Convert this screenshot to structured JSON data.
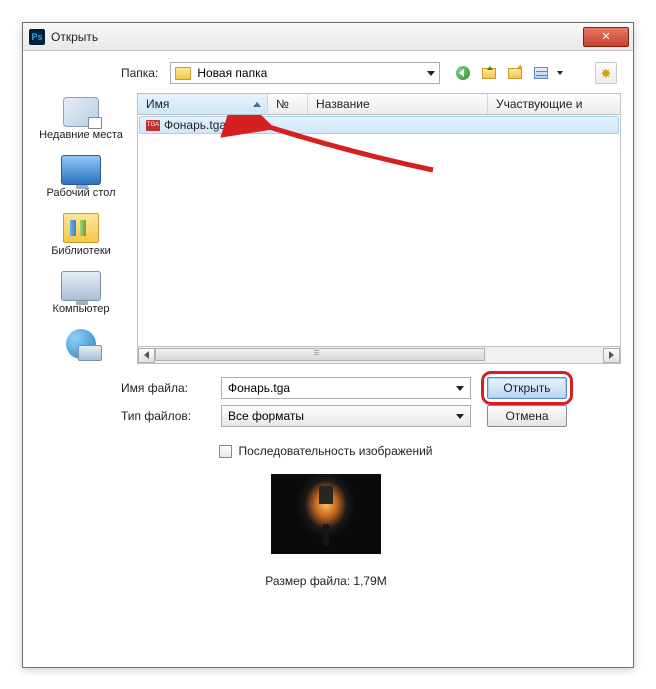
{
  "titlebar": {
    "title": "Открыть",
    "icon_text": "Ps"
  },
  "top": {
    "folder_label": "Папка:",
    "folder_value": "Новая папка"
  },
  "sidebar": {
    "items": [
      {
        "label": "Недавние места"
      },
      {
        "label": "Рабочий стол"
      },
      {
        "label": "Библиотеки"
      },
      {
        "label": "Компьютер"
      },
      {
        "label": ""
      }
    ]
  },
  "columns": {
    "name": "Имя",
    "num": "№",
    "title": "Название",
    "artists": "Участвующие и"
  },
  "files": [
    {
      "name": "Фонарь.tga",
      "icon": "TGA"
    }
  ],
  "form": {
    "filename_label": "Имя файла:",
    "filename_value": "Фонарь.tga",
    "filetype_label": "Тип файлов:",
    "filetype_value": "Все форматы",
    "open_btn": "Открыть",
    "cancel_btn": "Отмена",
    "sequence_label": "Последовательность изображений",
    "filesize_label": "Размер файла: 1,79M"
  }
}
